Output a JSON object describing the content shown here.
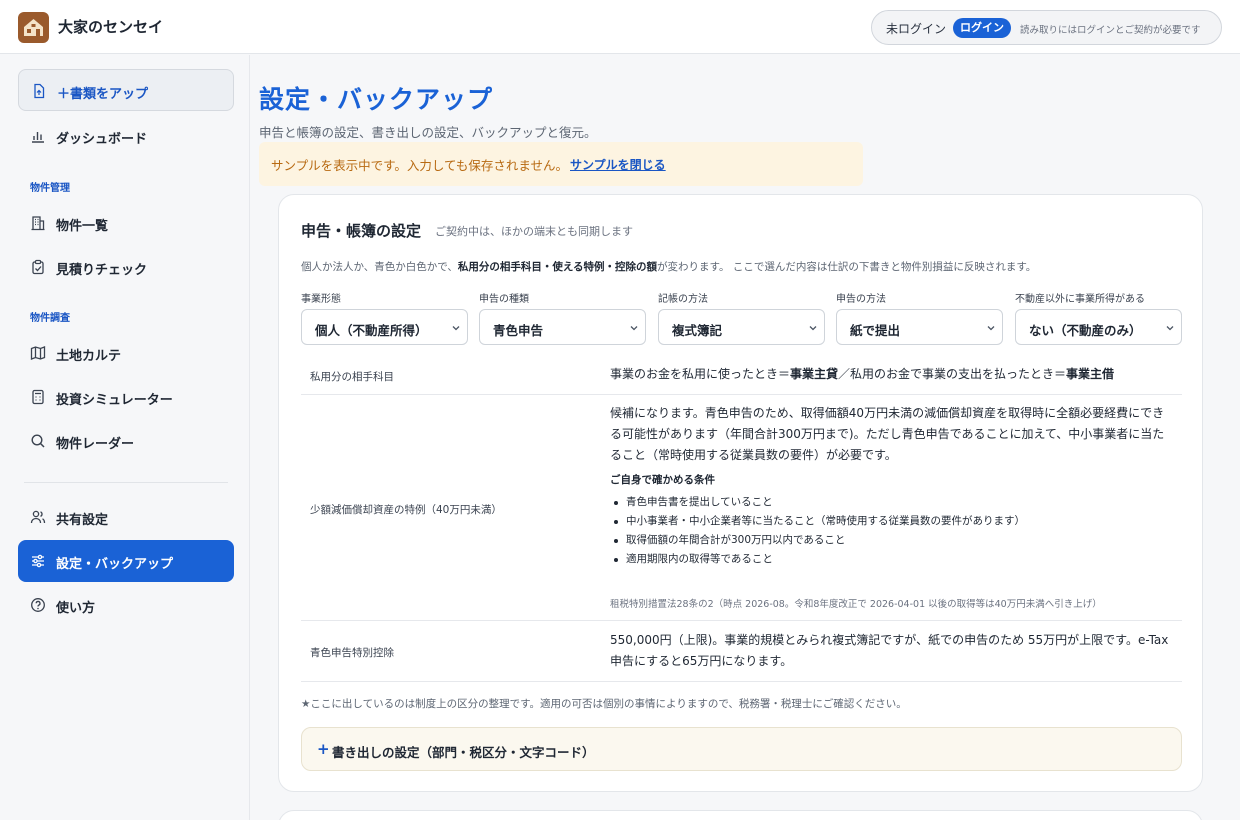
{
  "app": {
    "title": "大家のセンセイ"
  },
  "header": {
    "login_status": "未ログイン",
    "login_button": "ログイン",
    "login_note": "読み取りにはログインとご契約が必要です"
  },
  "sidebar": {
    "upload": "＋書類をアップ",
    "dashboard": "ダッシュボード",
    "section_property_mgmt": "物件管理",
    "property_list": "物件一覧",
    "estimate_check": "見積りチェック",
    "section_property_research": "物件調査",
    "land_chart": "土地カルテ",
    "investment_sim": "投資シミュレーター",
    "property_radar": "物件レーダー",
    "shared_settings": "共有設定",
    "settings_backup": "設定・バックアップ",
    "how_to_use": "使い方"
  },
  "main": {
    "title": "設定・バックアップ",
    "subtitle": "申告と帳簿の設定、書き出しの設定、バックアップと復元。",
    "sample_banner": "サンプルを表示中です。入力しても保存されません。",
    "sample_close": "サンプルを閉じる"
  },
  "card": {
    "title": "申告・帳簿の設定",
    "title_note": "ご契約中は、ほかの端末とも同期します",
    "desc_before": "個人か法人か、青色か白色かで、",
    "desc_bold": "私用分の相手科目・使える特例・控除の額",
    "desc_after": "が変わります。 ここで選んだ内容は仕訳の下書きと物件別損益に反映されます。",
    "fields": [
      {
        "label": "事業形態",
        "value": "個人（不動産所得）"
      },
      {
        "label": "申告の種類",
        "value": "青色申告"
      },
      {
        "label": "記帳の方法",
        "value": "複式簿記"
      },
      {
        "label": "申告の方法",
        "value": "紙で提出"
      },
      {
        "label": "不動産以外に事業所得がある",
        "value": "ない（不動産のみ）"
      }
    ],
    "row1": {
      "label": "私用分の相手科目",
      "v1": "事業のお金を私用に使ったとき＝",
      "v2": "事業主貸",
      "v3": "／私用のお金で事業の支出を払ったとき＝",
      "v4": "事業主借"
    },
    "row2": {
      "label": "少額減価償却資産の特例（40万円未満）",
      "value": "候補になります。青色申告のため、取得価額40万円未満の減価償却資産を取得時に全額必要経費にできる可能性があります（年間合計300万円まで)。ただし青色申告であることに加えて、中小事業者に当たること（常時使用する従業員数の要件）が必要です。",
      "cond_title": "ご自身で確かめる条件",
      "conds": [
        "青色申告書を提出していること",
        "中小事業者・中小企業者等に当たること（常時使用する従業員数の要件があります）",
        "取得価額の年間合計が300万円以内であること",
        "適用期限内の取得等であること"
      ],
      "law_note": "租税特別措置法28条の2（時点 2026-08。令和8年度改正で 2026-04-01 以後の取得等は40万円未満へ引き上げ）"
    },
    "row3": {
      "label": "青色申告特別控除",
      "value": "550,000円（上限)。事業的規模とみられ複式簿記ですが、紙での申告のため 55万円が上限です。e-Tax申告にすると65万円になります。"
    },
    "footnote": "★ここに出しているのは制度上の区分の整理です。適用の可否は個別の事情によりますので、税務署・税理士にご確認ください。",
    "export": "書き出しの設定（部門・税区分・文字コード）"
  }
}
